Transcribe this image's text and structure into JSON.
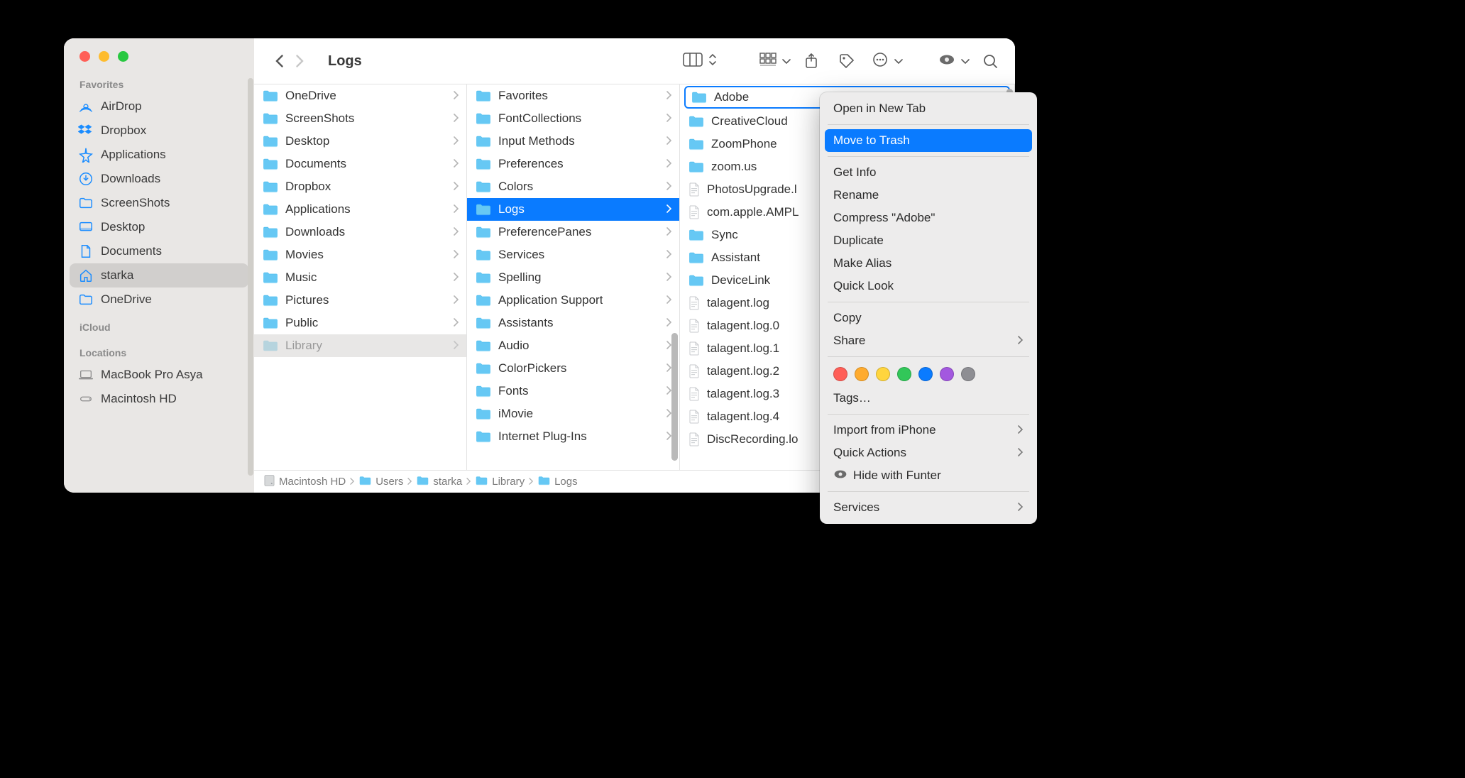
{
  "window": {
    "title": "Logs"
  },
  "sidebar": {
    "sections": [
      {
        "heading": "Favorites",
        "items": [
          {
            "icon": "airdrop",
            "label": "AirDrop"
          },
          {
            "icon": "dropbox",
            "label": "Dropbox"
          },
          {
            "icon": "app",
            "label": "Applications"
          },
          {
            "icon": "download",
            "label": "Downloads"
          },
          {
            "icon": "folder",
            "label": "ScreenShots"
          },
          {
            "icon": "desktop",
            "label": "Desktop"
          },
          {
            "icon": "doc",
            "label": "Documents"
          },
          {
            "icon": "home",
            "label": "starka",
            "selected": true
          },
          {
            "icon": "folder",
            "label": "OneDrive"
          }
        ]
      },
      {
        "heading": "iCloud",
        "items": []
      },
      {
        "heading": "Locations",
        "items": [
          {
            "icon": "laptop",
            "label": "MacBook Pro Asya"
          },
          {
            "icon": "disk",
            "label": "Macintosh HD"
          }
        ]
      }
    ]
  },
  "columns": [
    {
      "items": [
        {
          "type": "folder",
          "label": "OneDrive",
          "chev": true
        },
        {
          "type": "folder",
          "label": "ScreenShots",
          "chev": true
        },
        {
          "type": "folder",
          "label": "Desktop",
          "chev": true
        },
        {
          "type": "folder",
          "label": "Documents",
          "chev": true
        },
        {
          "type": "folder",
          "label": "Dropbox",
          "chev": true
        },
        {
          "type": "folder",
          "label": "Applications",
          "chev": true
        },
        {
          "type": "folder",
          "label": "Downloads",
          "chev": true
        },
        {
          "type": "folder",
          "label": "Movies",
          "chev": true
        },
        {
          "type": "folder",
          "label": "Music",
          "chev": true
        },
        {
          "type": "folder",
          "label": "Pictures",
          "chev": true
        },
        {
          "type": "folder",
          "label": "Public",
          "chev": true
        },
        {
          "type": "folder",
          "label": "Library",
          "chev": true,
          "dim": true
        }
      ]
    },
    {
      "items": [
        {
          "type": "folder",
          "label": "Favorites",
          "chev": true
        },
        {
          "type": "folder",
          "label": "FontCollections",
          "chev": true
        },
        {
          "type": "folder",
          "label": "Input Methods",
          "chev": true
        },
        {
          "type": "folder",
          "label": "Preferences",
          "chev": true
        },
        {
          "type": "folder",
          "label": "Colors",
          "chev": true
        },
        {
          "type": "folder",
          "label": "Logs",
          "chev": true,
          "selected": true
        },
        {
          "type": "folder",
          "label": "PreferencePanes",
          "chev": true
        },
        {
          "type": "folder",
          "label": "Services",
          "chev": true
        },
        {
          "type": "folder",
          "label": "Spelling",
          "chev": true
        },
        {
          "type": "folder",
          "label": "Application Support",
          "chev": true
        },
        {
          "type": "folder",
          "label": "Assistants",
          "chev": true
        },
        {
          "type": "folder",
          "label": "Audio",
          "chev": true
        },
        {
          "type": "folder",
          "label": "ColorPickers",
          "chev": true
        },
        {
          "type": "folder",
          "label": "Fonts",
          "chev": true
        },
        {
          "type": "folder",
          "label": "iMovie",
          "chev": true
        },
        {
          "type": "folder",
          "label": "Internet Plug-Ins",
          "chev": true
        }
      ]
    },
    {
      "items": [
        {
          "type": "folder",
          "label": "Adobe",
          "chev": true,
          "highlight": true
        },
        {
          "type": "folder",
          "label": "CreativeCloud",
          "chev": true
        },
        {
          "type": "folder",
          "label": "ZoomPhone",
          "chev": true
        },
        {
          "type": "folder",
          "label": "zoom.us",
          "chev": true
        },
        {
          "type": "file",
          "label": "PhotosUpgrade.l"
        },
        {
          "type": "file",
          "label": "com.apple.AMPL"
        },
        {
          "type": "folder",
          "label": "Sync",
          "chev": true
        },
        {
          "type": "folder",
          "label": "Assistant",
          "chev": true
        },
        {
          "type": "folder",
          "label": "DeviceLink",
          "chev": true
        },
        {
          "type": "file",
          "label": "talagent.log"
        },
        {
          "type": "file",
          "label": "talagent.log.0"
        },
        {
          "type": "file",
          "label": "talagent.log.1"
        },
        {
          "type": "file",
          "label": "talagent.log.2"
        },
        {
          "type": "file",
          "label": "talagent.log.3"
        },
        {
          "type": "file",
          "label": "talagent.log.4"
        },
        {
          "type": "file",
          "label": "DiscRecording.lo"
        }
      ]
    }
  ],
  "pathbar": [
    "Macintosh HD",
    "Users",
    "starka",
    "Library",
    "Logs"
  ],
  "menu": {
    "items": [
      {
        "t": "item",
        "label": "Open in New Tab"
      },
      {
        "t": "sep"
      },
      {
        "t": "item",
        "label": "Move to Trash",
        "selected": true
      },
      {
        "t": "sep"
      },
      {
        "t": "item",
        "label": "Get Info"
      },
      {
        "t": "item",
        "label": "Rename"
      },
      {
        "t": "item",
        "label": "Compress \"Adobe\""
      },
      {
        "t": "item",
        "label": "Duplicate"
      },
      {
        "t": "item",
        "label": "Make Alias"
      },
      {
        "t": "item",
        "label": "Quick Look"
      },
      {
        "t": "sep"
      },
      {
        "t": "item",
        "label": "Copy"
      },
      {
        "t": "item",
        "label": "Share",
        "submenu": true
      },
      {
        "t": "sep"
      },
      {
        "t": "tags",
        "colors": [
          "#ff5e57",
          "#ffab2e",
          "#ffd53e",
          "#32c759",
          "#0a7bff",
          "#a358df",
          "#8e8e93"
        ]
      },
      {
        "t": "item",
        "label": "Tags…"
      },
      {
        "t": "sep"
      },
      {
        "t": "item",
        "label": "Import from iPhone",
        "submenu": true
      },
      {
        "t": "item",
        "label": "Quick Actions",
        "submenu": true
      },
      {
        "t": "item",
        "label": "Hide with Funter",
        "icon": "eye"
      },
      {
        "t": "sep"
      },
      {
        "t": "item",
        "label": "Services",
        "submenu": true
      }
    ]
  }
}
